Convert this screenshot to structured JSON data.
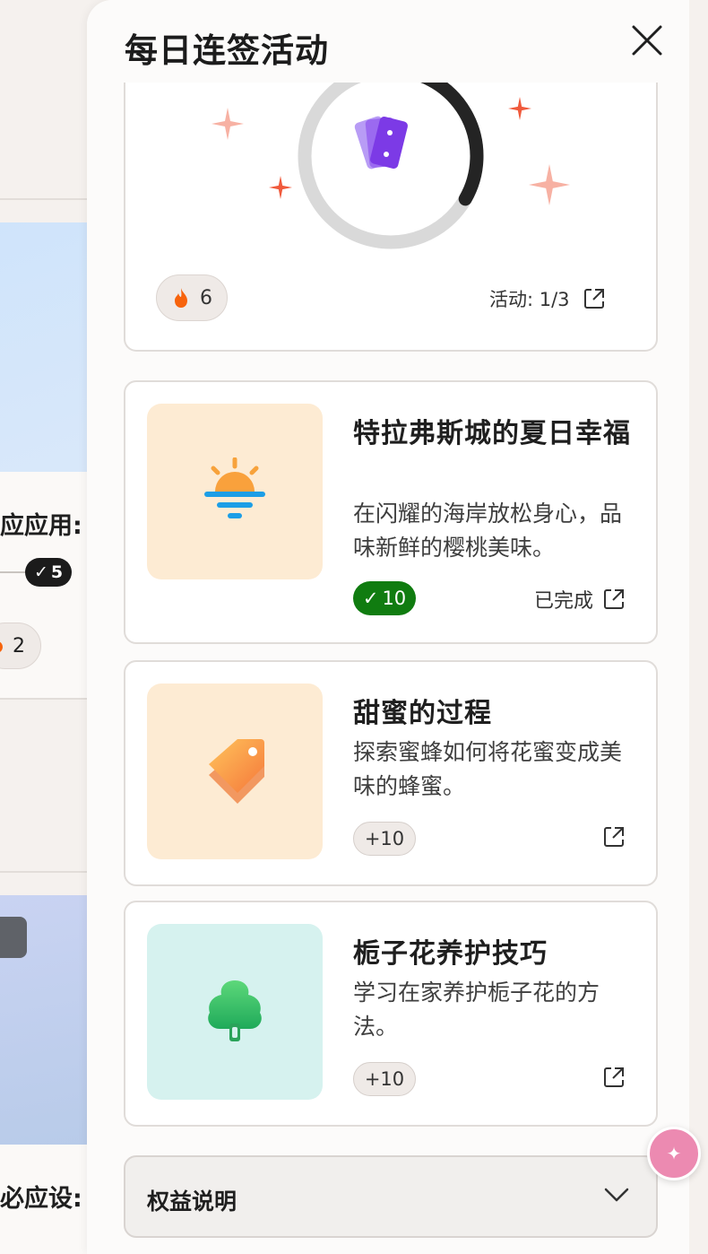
{
  "panel": {
    "title": "每日连签活动",
    "close_icon": "close-icon"
  },
  "progress": {
    "center_icon": "cards-icon",
    "ring_progress": 0.333,
    "streak_icon": "fire-icon",
    "streak_count": "6",
    "activity_label": "活动: 1/3",
    "activity_icon": "open-external-icon"
  },
  "activities": [
    {
      "thumb_icon": "sunset-icon",
      "thumb_bg": "#fdebd3",
      "title": "特拉弗斯城的夏日幸福",
      "description": "在闪耀的海岸放松身心，品味新鲜的樱桃美味。",
      "points": "10",
      "completed": true,
      "status": "已完成",
      "link_icon": "open-external-icon"
    },
    {
      "thumb_icon": "tag-icon",
      "thumb_bg": "#fdebd3",
      "title": "甜蜜的过程",
      "description": "探索蜜蜂如何将花蜜变成美味的蜂蜜。",
      "points": "+10",
      "completed": false,
      "status": "",
      "link_icon": "open-external-icon"
    },
    {
      "thumb_icon": "tree-icon",
      "thumb_bg": "#d6f2ef",
      "title": "栀子花养护技巧",
      "description": "学习在家养护栀子花的方法。",
      "points": "+10",
      "completed": false,
      "status": "",
      "link_icon": "open-external-icon"
    }
  ],
  "benefits": {
    "label": "权益说明",
    "icon": "chevron-down-icon"
  },
  "background": {
    "card1_title": "应应用:",
    "card1_check_count": "5",
    "card1_streak": "2",
    "card2_title": "必应设:"
  },
  "colors": {
    "done_green": "#107c10",
    "ring_track": "#d9d9d9",
    "ring_fill": "#242424",
    "fire": "#f7630c",
    "sparkle_red": "#f05a3c",
    "sparkle_pink": "#f7b1a3"
  }
}
